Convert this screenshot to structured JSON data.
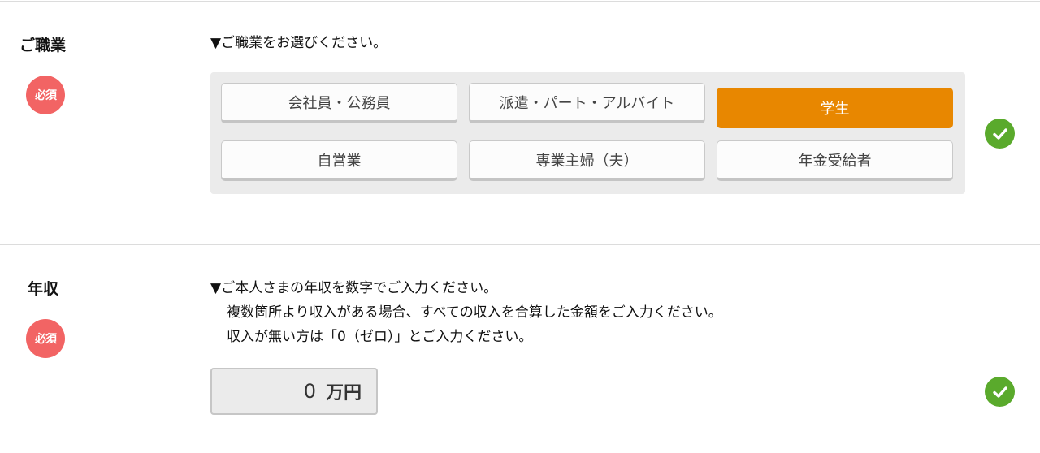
{
  "occupation": {
    "label": "ご職業",
    "required_badge": "必須",
    "instruction": "▼ご職業をお選びください。",
    "options": [
      {
        "label": "会社員・公務員",
        "selected": false
      },
      {
        "label": "派遣・パート・アルバイト",
        "selected": false
      },
      {
        "label": "学生",
        "selected": true
      },
      {
        "label": "自営業",
        "selected": false
      },
      {
        "label": "専業主婦（夫）",
        "selected": false
      },
      {
        "label": "年金受給者",
        "selected": false
      }
    ],
    "status_icon": "check-circle-icon"
  },
  "income": {
    "label": "年収",
    "required_badge": "必須",
    "instruction_lines": [
      "▼ご本人さまの年収を数字でご入力ください。",
      "複数箇所より収入がある場合、すべての収入を合算した金額をご入力ください。",
      "収入が無い方は「0（ゼロ）」とご入力ください。"
    ],
    "value": "0",
    "unit": "万円",
    "status_icon": "check-circle-icon"
  },
  "colors": {
    "selected": "#e88700",
    "badge": "#f26464",
    "check": "#5aaa2c"
  }
}
